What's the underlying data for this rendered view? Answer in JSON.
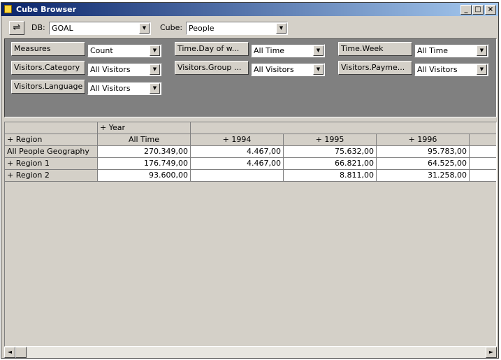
{
  "window": {
    "title": "Cube Browser"
  },
  "caption_buttons": {
    "minimize": "_",
    "maximize": "□",
    "close": "×"
  },
  "toolbar": {
    "db_label": "DB:",
    "db_value": "GOAL",
    "cube_label": "Cube:",
    "cube_value": "People"
  },
  "filters": [
    {
      "dimension": "Measures",
      "value": "Count"
    },
    {
      "dimension": "Time.Day of w...",
      "value": "All Time"
    },
    {
      "dimension": "Time.Week",
      "value": "All Time"
    },
    {
      "dimension": "Visitors.Category",
      "value": "All Visitors"
    },
    {
      "dimension": "Visitors.Group ...",
      "value": "All Visitors"
    },
    {
      "dimension": "Visitors.Payme...",
      "value": "All Visitors"
    },
    {
      "dimension": "Visitors.Language",
      "value": "All Visitors"
    }
  ],
  "grid": {
    "column_dimension": "+ Year",
    "row_dimension": "+ Region",
    "columns": [
      "All Time",
      "+ 1994",
      "+ 1995",
      "+ 1996"
    ],
    "rows": [
      {
        "label": "All People Geography",
        "values": [
          "270.349,00",
          "4.467,00",
          "75.632,00",
          "95.783,00"
        ]
      },
      {
        "label": "+ Region 1",
        "values": [
          "176.749,00",
          "4.467,00",
          "66.821,00",
          "64.525,00"
        ]
      },
      {
        "label": "+ Region 2",
        "values": [
          "93.600,00",
          "",
          "8.811,00",
          "31.258,00"
        ]
      }
    ]
  },
  "icons": {
    "connect": "connect-icon",
    "dropdown": "▼",
    "scroll_left": "◄",
    "scroll_right": "►"
  }
}
